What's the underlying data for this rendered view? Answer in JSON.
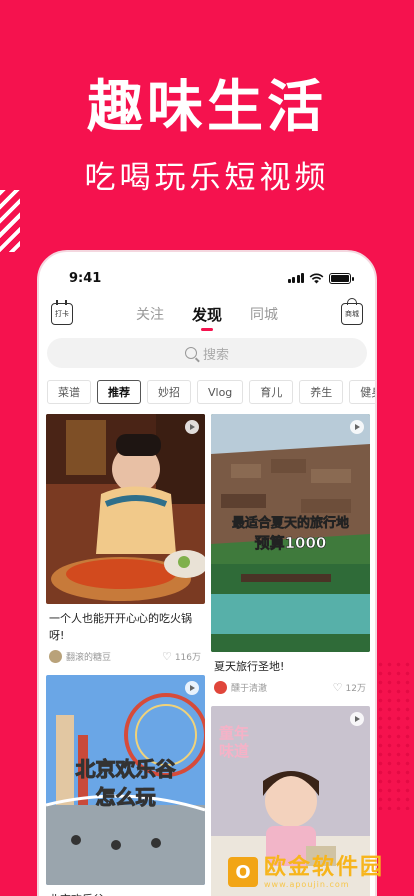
{
  "promo": {
    "title": "趣味生活",
    "subtitle": "吃喝玩乐短视频"
  },
  "status_bar": {
    "time": "9:41"
  },
  "top_nav": {
    "left_icon_label": "打卡",
    "right_icon_label": "商城",
    "tabs": [
      {
        "label": "关注",
        "active": false
      },
      {
        "label": "发现",
        "active": true
      },
      {
        "label": "同城",
        "active": false
      }
    ]
  },
  "search": {
    "placeholder": "搜索"
  },
  "categories": [
    {
      "label": "菜谱",
      "active": false
    },
    {
      "label": "推荐",
      "active": true
    },
    {
      "label": "妙招",
      "active": false
    },
    {
      "label": "Vlog",
      "active": false
    },
    {
      "label": "育儿",
      "active": false
    },
    {
      "label": "养生",
      "active": false
    },
    {
      "label": "健身",
      "active": false
    }
  ],
  "feed": {
    "left": [
      {
        "title": "一个人也能开开心心的吃火锅呀!",
        "author": "翻滚的糖豆",
        "likes": "116万",
        "overlay": ""
      },
      {
        "title": "北京欢乐谷",
        "author": "",
        "likes": "",
        "overlay_line1": "北京欢乐谷",
        "overlay_line2": "怎么玩"
      }
    ],
    "right": [
      {
        "title": "夏天旅行圣地!",
        "author": "醺于清澈",
        "likes": "12万",
        "overlay_line1": "最适合夏天的旅行地",
        "overlay_line2": "预算1000"
      },
      {
        "title": "",
        "overlay_text": "童年味道"
      }
    ]
  },
  "watermark": {
    "main": "欧金软件园",
    "url": "www.apoujin.com",
    "logo_char": "O"
  },
  "colors": {
    "brand": "#F5124E"
  }
}
